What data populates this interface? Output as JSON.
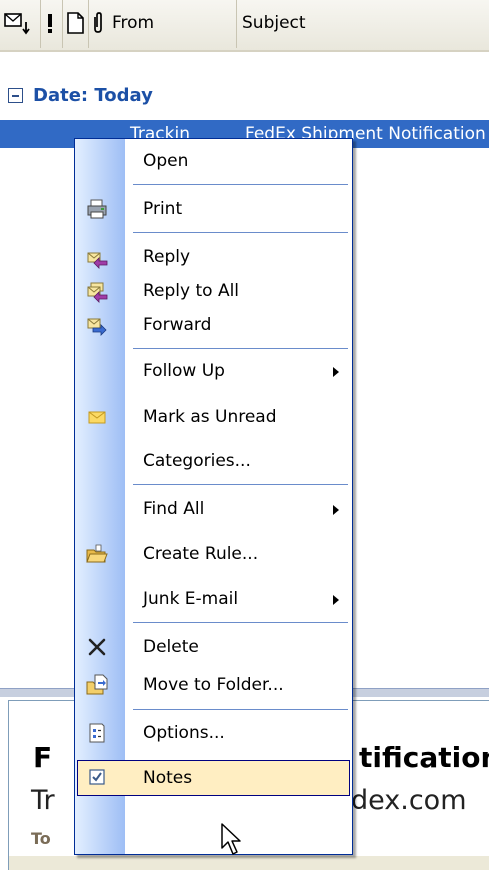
{
  "column_header": {
    "from_label": "From",
    "subject_label": "Subject"
  },
  "group": {
    "label": "Date: Today"
  },
  "selected_row": {
    "from": "Trackin",
    "subject": "FedEx Shipment Notification"
  },
  "reading_pane": {
    "title": "F",
    "title_end": "tification",
    "from_start": "Tr",
    "from_end": "dex.com",
    "date_start": "To"
  },
  "menu": {
    "items": [
      {
        "label": "Open",
        "icon": ""
      },
      {
        "label": "Print",
        "icon": "printer-icon"
      },
      {
        "label": "Reply",
        "icon": "reply-icon"
      },
      {
        "label": "Reply to All",
        "icon": "reply-all-icon"
      },
      {
        "label": "Forward",
        "icon": "forward-icon"
      },
      {
        "label": "Follow Up",
        "icon": "",
        "submenu": true
      },
      {
        "label": "Mark as Unread",
        "icon": "envelope-icon"
      },
      {
        "label": "Categories...",
        "icon": ""
      },
      {
        "label": "Find All",
        "icon": "",
        "submenu": true
      },
      {
        "label": "Create Rule...",
        "icon": "folder-rule-icon"
      },
      {
        "label": "Junk E-mail",
        "icon": "",
        "submenu": true
      },
      {
        "label": "Delete",
        "icon": "delete-x-icon"
      },
      {
        "label": "Move to Folder...",
        "icon": "move-folder-icon"
      },
      {
        "label": "Options...",
        "icon": "options-icon"
      },
      {
        "label": "Notes",
        "icon": "checkbox-icon",
        "highlighted": true
      }
    ]
  },
  "colors": {
    "selection": "#316ac5",
    "menu_border": "#002d96",
    "highlight": "#ffeec2",
    "group_text": "#1c50a6"
  }
}
